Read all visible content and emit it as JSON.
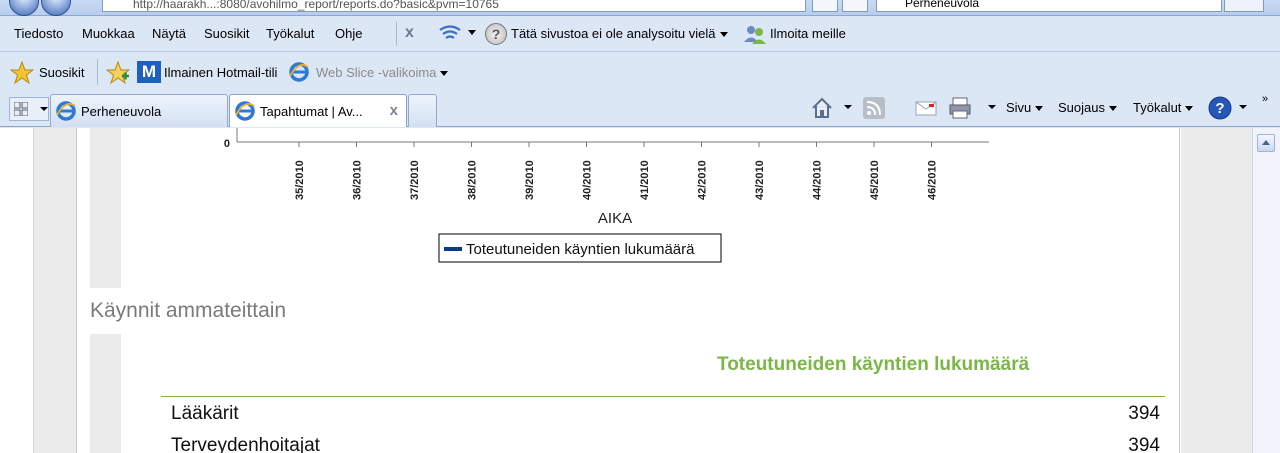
{
  "browser": {
    "address": "http://haarakh...:8080/avohilmo_report/reports.do?basic&pvm=10765",
    "search_value": "Perheneuvola",
    "menu": [
      "Tiedosto",
      "Muokkaa",
      "Näytä",
      "Suosikit",
      "Työkalut",
      "Ohje"
    ],
    "analysis_text": "Tätä sivustoa ei ole analysoitu vielä",
    "report_text": "Ilmoita meille",
    "favorites_label": "Suosikit",
    "hotmail_label": "Ilmainen Hotmail-tili",
    "webslice_label": "Web Slice -valikoima",
    "tabs": [
      {
        "label": "Perheneuvola"
      },
      {
        "label": "Tapahtumat | Av..."
      }
    ],
    "commands": {
      "page": "Sivu",
      "safety": "Suojaus",
      "tools": "Työkalut"
    }
  },
  "chart_data": {
    "type": "line",
    "categories": [
      "35/2010",
      "36/2010",
      "37/2010",
      "38/2010",
      "39/2010",
      "40/2010",
      "41/2010",
      "42/2010",
      "43/2010",
      "44/2010",
      "45/2010",
      "46/2010"
    ],
    "xlabel": "AIKA",
    "y_tick_visible": "0",
    "series": [
      {
        "name": "Toteutuneiden käyntien lukumäärä",
        "color": "#0a3a8c"
      }
    ],
    "legend": "bottom-center"
  },
  "section": {
    "title": "Käynnit ammateittain",
    "column_header": "Toteutuneiden käyntien lukumäärä",
    "rows": [
      {
        "label": "Lääkärit",
        "value": "394"
      },
      {
        "label": "Terveydenhoitajat",
        "value": "394"
      }
    ]
  }
}
